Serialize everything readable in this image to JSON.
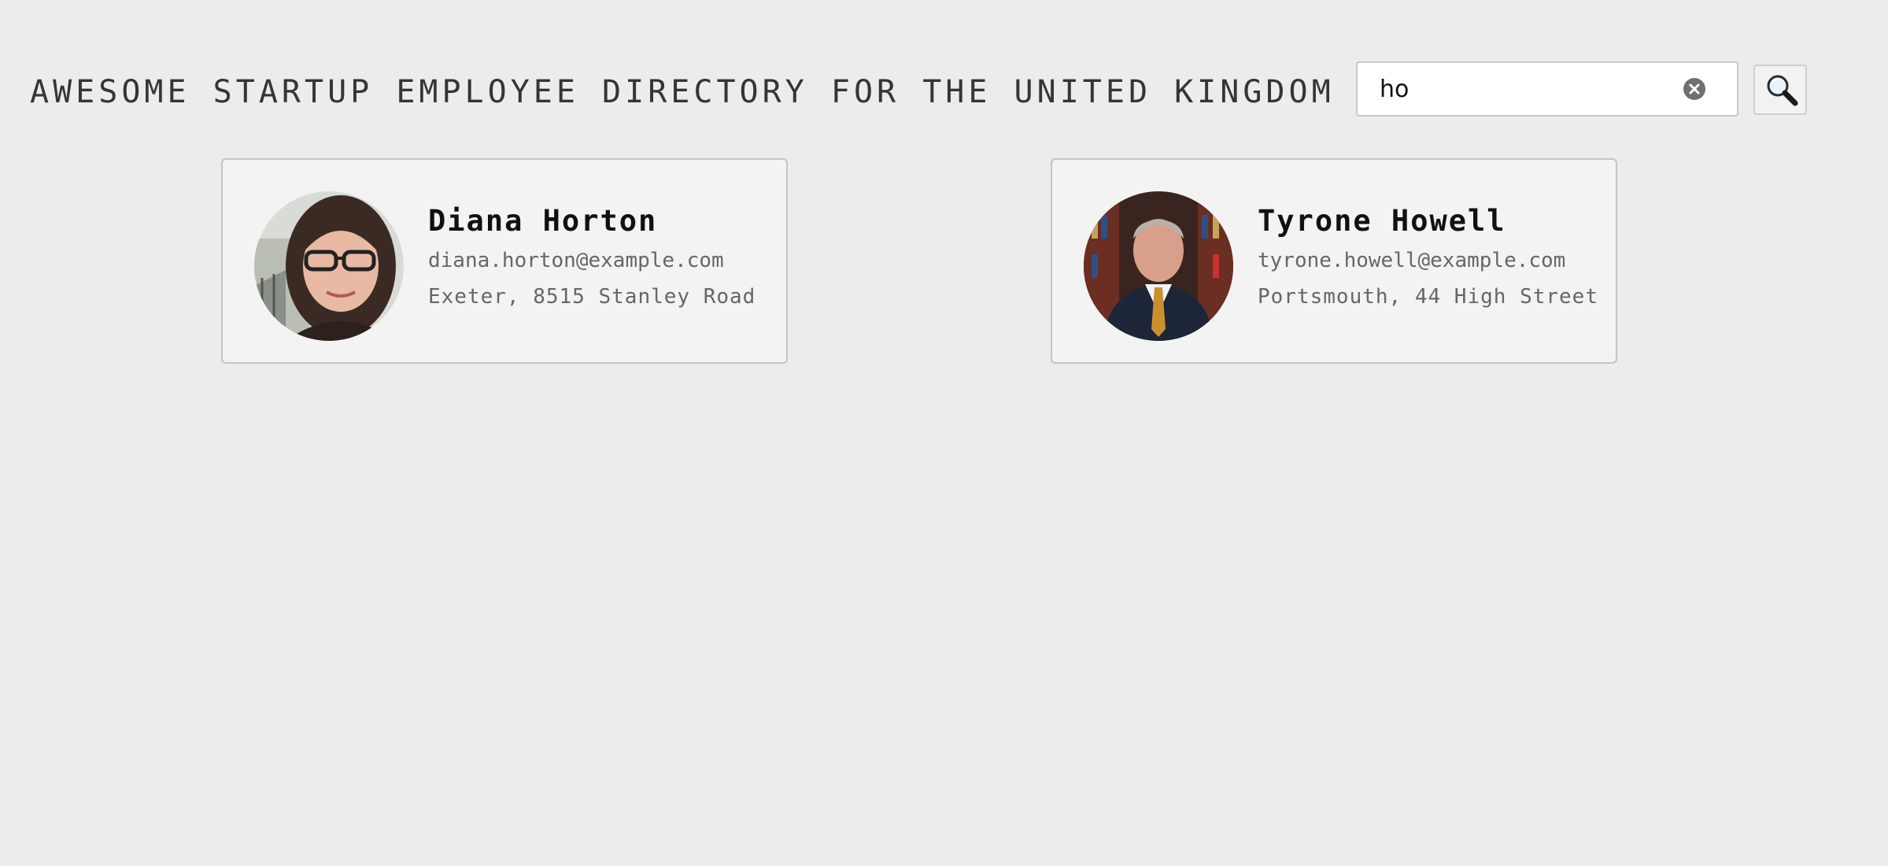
{
  "header": {
    "title": "AWESOME STARTUP EMPLOYEE DIRECTORY FOR THE UNITED KINGDOM"
  },
  "search": {
    "value": "ho",
    "clear_icon": "clear-circle-icon",
    "button_icon": "magnifier-icon"
  },
  "employees": [
    {
      "name": "Diana Horton",
      "email": "diana.horton@example.com",
      "address": "Exeter, 8515 Stanley Road"
    },
    {
      "name": "Tyrone Howell",
      "email": "tyrone.howell@example.com",
      "address": "Portsmouth, 44 High Street"
    }
  ]
}
